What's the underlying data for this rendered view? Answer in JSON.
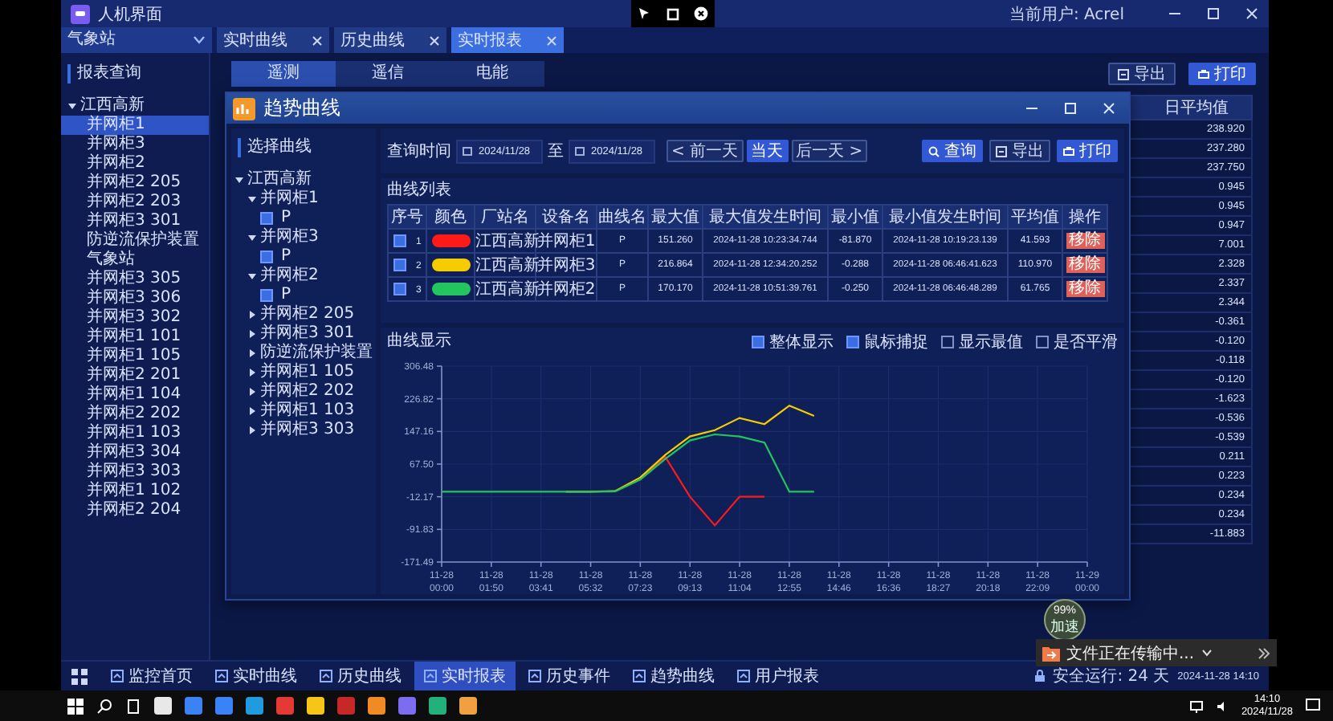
{
  "window": {
    "title": "人机界面",
    "current_user": "当前用户: Acrel"
  },
  "station_select": {
    "value": "气象站"
  },
  "open_tabs": [
    {
      "label": "实时曲线",
      "selected": false
    },
    {
      "label": "历史曲线",
      "selected": false
    },
    {
      "label": "实时报表",
      "selected": true
    }
  ],
  "sidebar": {
    "title": "报表查询",
    "tree": [
      {
        "label": "江西高新",
        "expanded": true,
        "children": [
          {
            "label": "并网柜1",
            "selected": true
          },
          {
            "label": "并网柜3",
            "selected": false
          },
          {
            "label": "并网柜2",
            "selected": false
          },
          {
            "label": "并网柜2 205",
            "selected": false
          },
          {
            "label": "并网柜2 203",
            "selected": false
          },
          {
            "label": "并网柜3 301",
            "selected": false
          },
          {
            "label": "防逆流保护装置",
            "selected": false
          },
          {
            "label": "气象站",
            "selected": false
          },
          {
            "label": "并网柜3 305",
            "selected": false
          },
          {
            "label": "并网柜3 306",
            "selected": false
          },
          {
            "label": "并网柜3 302",
            "selected": false
          },
          {
            "label": "并网柜1 101",
            "selected": false
          },
          {
            "label": "并网柜1 105",
            "selected": false
          },
          {
            "label": "并网柜2 201",
            "selected": false
          },
          {
            "label": "并网柜1 104",
            "selected": false
          },
          {
            "label": "并网柜2 202",
            "selected": false
          },
          {
            "label": "并网柜1 103",
            "selected": false
          },
          {
            "label": "并网柜3 304",
            "selected": false
          },
          {
            "label": "并网柜3 303",
            "selected": false
          },
          {
            "label": "并网柜1 102",
            "selected": false
          },
          {
            "label": "并网柜2 204",
            "selected": false
          }
        ]
      }
    ]
  },
  "report_tabs": [
    {
      "label": "遥测",
      "selected": true
    },
    {
      "label": "遥信",
      "selected": false
    },
    {
      "label": "电能",
      "selected": false
    }
  ],
  "report_buttons": [
    {
      "label": "导出",
      "kind": "export"
    },
    {
      "label": "打印",
      "kind": "print"
    }
  ],
  "report_table": {
    "column": "日平均值",
    "rows": [
      "238.920",
      "237.280",
      "237.750",
      "0.945",
      "0.945",
      "0.947",
      "7.001",
      "2.328",
      "2.337",
      "2.344",
      "-0.361",
      "-0.120",
      "-0.118",
      "-0.120",
      "-1.623",
      "-0.536",
      "-0.539",
      "0.211",
      "0.223",
      "0.234",
      "0.234",
      "-11.883"
    ]
  },
  "trend_dialog": {
    "title": "趋势曲线",
    "tree_title": "选择曲线",
    "tree": [
      {
        "label": "江西高新",
        "expanded": true,
        "children": [
          {
            "label": "并网柜1",
            "expanded": true,
            "children": [
              {
                "label": "P",
                "checked": true
              }
            ]
          },
          {
            "label": "并网柜3",
            "expanded": true,
            "children": [
              {
                "label": "P",
                "checked": true
              }
            ]
          },
          {
            "label": "并网柜2",
            "expanded": true,
            "children": [
              {
                "label": "P",
                "checked": true
              }
            ]
          },
          {
            "label": "并网柜2 205",
            "expanded": false
          },
          {
            "label": "并网柜3 301",
            "expanded": false
          },
          {
            "label": "防逆流保护装置",
            "expanded": false
          },
          {
            "label": "并网柜1 105",
            "expanded": false
          },
          {
            "label": "并网柜2 202",
            "expanded": false
          },
          {
            "label": "并网柜1 103",
            "expanded": false
          },
          {
            "label": "并网柜3 303",
            "expanded": false
          }
        ]
      }
    ],
    "query": {
      "label": "查询时间",
      "start": "2024/11/28",
      "to": "至",
      "end": "2024/11/28",
      "days": [
        {
          "label": "< 前一天",
          "selected": false
        },
        {
          "label": "当天",
          "selected": true
        },
        {
          "label": "后一天 >",
          "selected": false
        }
      ],
      "actions": [
        {
          "label": "查询",
          "kind": "search"
        },
        {
          "label": "导出",
          "kind": "export"
        },
        {
          "label": "打印",
          "kind": "print"
        }
      ]
    },
    "curve_list": {
      "title": "曲线列表",
      "columns": [
        "序号",
        "颜色",
        "厂站名",
        "设备名",
        "曲线名",
        "最大值",
        "最大值发生时间",
        "最小值",
        "最小值发生时间",
        "平均值",
        "操作"
      ],
      "rows": [
        {
          "checked": true,
          "index": "1",
          "color": "#ff1a1a",
          "station": "江西高新",
          "device": "并网柜1",
          "curve": "P",
          "max": "151.260",
          "max_time": "2024-11-28 10:23:34.744",
          "min": "-81.870",
          "min_time": "2024-11-28 10:19:23.139",
          "avg": "41.593",
          "action": "移除"
        },
        {
          "checked": true,
          "index": "2",
          "color": "#f5cc00",
          "station": "江西高新",
          "device": "并网柜3",
          "curve": "P",
          "max": "216.864",
          "max_time": "2024-11-28 12:34:20.252",
          "min": "-0.288",
          "min_time": "2024-11-28 06:46:41.623",
          "avg": "110.970",
          "action": "移除"
        },
        {
          "checked": true,
          "index": "3",
          "color": "#22c55e",
          "station": "江西高新",
          "device": "并网柜2",
          "curve": "P",
          "max": "170.170",
          "max_time": "2024-11-28 10:51:39.761",
          "min": "-0.250",
          "min_time": "2024-11-28 06:46:48.289",
          "avg": "61.765",
          "action": "移除"
        }
      ]
    },
    "chart_panel": {
      "title": "曲线显示",
      "options": [
        {
          "label": "整体显示",
          "checked": true
        },
        {
          "label": "鼠标捕捉",
          "checked": true
        },
        {
          "label": "显示最值",
          "checked": false
        },
        {
          "label": "是否平滑",
          "checked": false
        }
      ],
      "chart_data": {
        "type": "line",
        "categories": [
          "11-28 00:00",
          null,
          "11-28 01:50",
          null,
          "11-28 03:41",
          null,
          "11-28 05:32",
          null,
          "11-28 07:23",
          null,
          "11-28 09:13",
          null,
          "11-28 11:04",
          null,
          "11-28 12:55",
          null,
          "11-28 14:46",
          null,
          "11-28 16:36",
          null,
          "11-28 18:27",
          null,
          "11-28 20:18",
          null,
          "11-28 22:09",
          null,
          "11-29 00:00"
        ],
        "ylim": [
          -171.49,
          306.48
        ],
        "grid": true,
        "yticks": [
          {
            "value": 306.48,
            "label": "306.48"
          },
          {
            "value": 226.82,
            "label": "226.82"
          },
          {
            "value": 147.16,
            "label": "147.16"
          },
          {
            "value": 67.5,
            "label": "67.50"
          },
          {
            "value": -12.17,
            "label": "-12.17"
          },
          {
            "value": -91.83,
            "label": "-91.83"
          },
          {
            "value": -171.49,
            "label": "-171.49"
          }
        ],
        "series": [
          {
            "color": "#ff1a1a",
            "values": [
              null,
              null,
              null,
              null,
              null,
              null,
              null,
              null,
              32,
              85,
              -12,
              -82,
              -12,
              -12,
              null,
              null,
              null,
              null,
              null,
              null,
              null,
              null,
              null,
              null,
              null,
              null,
              null
            ]
          },
          {
            "color": "#f5cc00",
            "values": [
              null,
              null,
              null,
              null,
              null,
              0,
              0,
              2,
              35,
              90,
              135,
              150,
              180,
              165,
              210,
              185,
              null,
              null,
              null,
              null,
              null,
              null,
              null,
              null,
              null,
              null,
              null
            ]
          },
          {
            "color": "#22c55e",
            "values": [
              0,
              0,
              0,
              0,
              0,
              0,
              0,
              1,
              30,
              80,
              125,
              140,
              135,
              120,
              0,
              0,
              null,
              null,
              null,
              null,
              null,
              null,
              null,
              null,
              null,
              null,
              null
            ]
          }
        ]
      }
    }
  },
  "bottom_nav": [
    {
      "label": "监控首页",
      "selected": false
    },
    {
      "label": "实时曲线",
      "selected": false
    },
    {
      "label": "历史曲线",
      "selected": false
    },
    {
      "label": "实时报表",
      "selected": true
    },
    {
      "label": "历史事件",
      "selected": false
    },
    {
      "label": "趋势曲线",
      "selected": false
    },
    {
      "label": "用户报表",
      "selected": false
    }
  ],
  "status": {
    "uptime": "安全运行: 24 天",
    "datetime": "2024-11-28 14:10"
  },
  "float_ball": {
    "value": "99%",
    "label": "加速"
  },
  "toast": {
    "text": "文件正在传输中..."
  },
  "taskbar": {
    "time": "14:10",
    "date": "2024/11/28"
  }
}
